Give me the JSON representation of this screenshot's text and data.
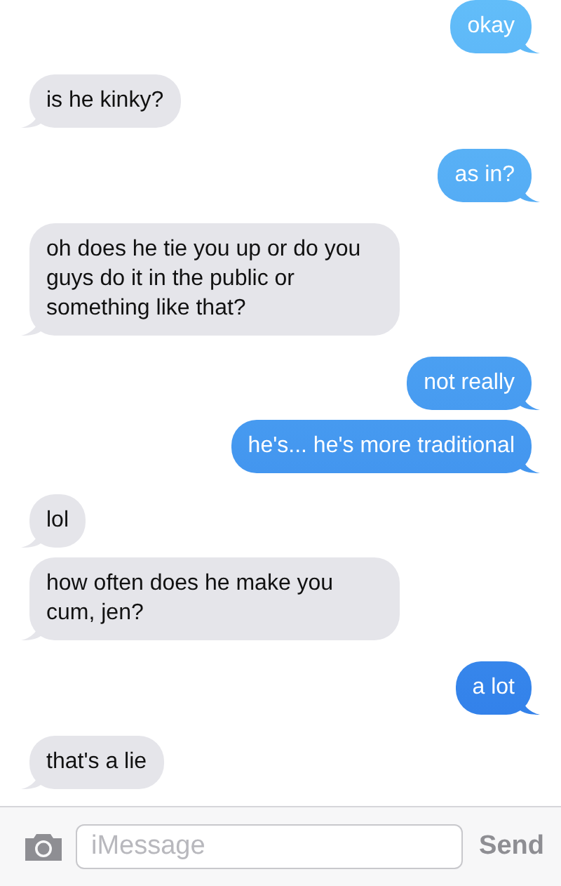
{
  "messages": [
    {
      "kind": "sent",
      "text": "okay"
    },
    {
      "kind": "received",
      "text": "is he kinky?"
    },
    {
      "kind": "sent",
      "text": "as in?"
    },
    {
      "kind": "received",
      "text": "oh does he tie you up or do you guys do it in the public or something like that?"
    },
    {
      "kind": "sent",
      "text": "not really"
    },
    {
      "kind": "sent",
      "text": "he's... he's more traditional"
    },
    {
      "kind": "received",
      "text": "lol"
    },
    {
      "kind": "received",
      "text": "how often does he make you cum, jen?"
    },
    {
      "kind": "sent",
      "text": "a lot"
    },
    {
      "kind": "received",
      "text": "that's a lie"
    }
  ],
  "composer": {
    "placeholder": "iMessage",
    "send": {
      "label": "Send",
      "disabled": true
    }
  }
}
